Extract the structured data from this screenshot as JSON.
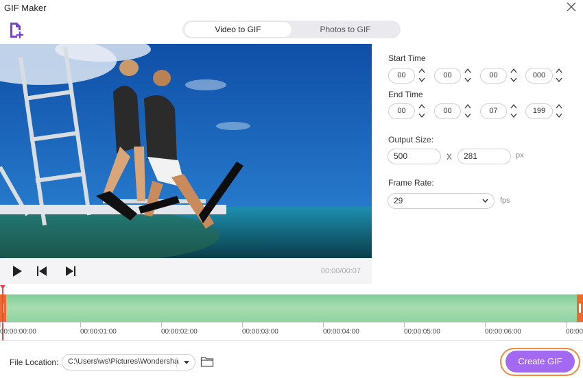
{
  "window": {
    "title": "GIF Maker"
  },
  "tabs": [
    {
      "label": "Video to GIF",
      "active": true
    },
    {
      "label": "Photos to GIF",
      "active": false
    }
  ],
  "player": {
    "time_readout": "00:00/00:07"
  },
  "settings": {
    "start_time": {
      "label": "Start Time",
      "hours": "00",
      "minutes": "00",
      "seconds": "00",
      "milliseconds": "000"
    },
    "end_time": {
      "label": "End Time",
      "hours": "00",
      "minutes": "00",
      "seconds": "07",
      "milliseconds": "199"
    },
    "output_size": {
      "label": "Output Size:",
      "width": "500",
      "separator": "X",
      "height": "281",
      "unit": "px"
    },
    "frame_rate": {
      "label": "Frame Rate:",
      "value": "29",
      "unit": "fps"
    }
  },
  "timeline": {
    "tick_labels": [
      "00:00:00:00",
      "00:00:01:00",
      "00:00:02:00",
      "00:00:03:00",
      "00:00:04:00",
      "00:00:05:00",
      "00:00:06:00",
      "00:00"
    ]
  },
  "footer": {
    "file_location_label": "File Location:",
    "path": "C:\\Users\\ws\\Pictures\\Wondershare",
    "create_label": "Create GIF"
  },
  "colors": {
    "accent_purple": "#a369f0",
    "highlight_orange": "#f08a3c",
    "trim_handle": "#ec6a2c",
    "timeline_green": "#8fd3a2",
    "playhead_red": "#e5484d"
  },
  "icons": {
    "add_file": "add-file-icon",
    "close": "close-icon",
    "play": "play-icon",
    "previous": "previous-frame-icon",
    "next": "next-frame-icon",
    "folder": "folder-icon",
    "caret": "chevron-down-icon"
  }
}
